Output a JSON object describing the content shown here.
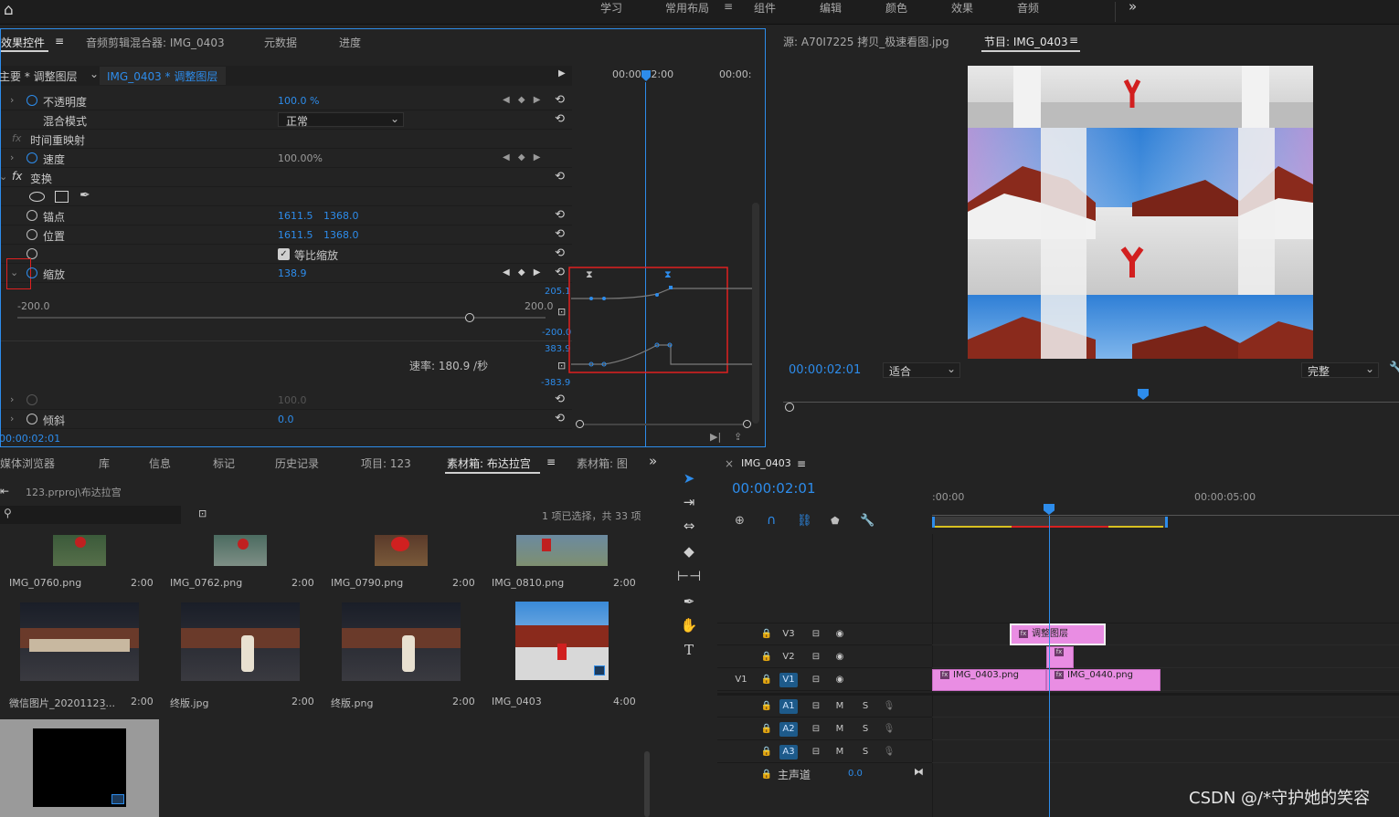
{
  "workspace": {
    "tabs": [
      "学习",
      "常用布局",
      "组件",
      "编辑",
      "颜色",
      "效果",
      "音频"
    ],
    "active_tab": "常用布局",
    "menu_icon": "≡",
    "more_icon": "»",
    "home_icon": "home-icon"
  },
  "effect_controls": {
    "tabs": [
      "效果控件",
      "音频剪辑混合器: IMG_0403",
      "元数据",
      "进度"
    ],
    "active_tab": "效果控件",
    "tab_menu": "≡",
    "source_label": "主要 * 调整图层",
    "sequence_label": "IMG_0403 * 调整图层",
    "ruler_times": [
      "00:00",
      "00:00:02:00",
      "00:00:"
    ],
    "rows": {
      "opacity": {
        "label": "不透明度",
        "value": "100.0 %"
      },
      "blend": {
        "label": "混合模式",
        "value": "正常"
      },
      "time_remap": {
        "label": "时间重映射"
      },
      "speed": {
        "label": "速度",
        "value": "100.00%"
      },
      "transform": {
        "label": "变换"
      },
      "anchor": {
        "label": "锚点",
        "x": "1611.5",
        "y": "1368.0"
      },
      "position": {
        "label": "位置",
        "x": "1611.5",
        "y": "1368.0"
      },
      "uniform": {
        "label": "等比缩放"
      },
      "scale": {
        "label": "缩放",
        "value": "138.9"
      },
      "slider_min": "-200.0",
      "slider_max": "200.0",
      "rate": "速率: 180.9 /秒",
      "g1_top": "205.1",
      "g1_bot": "-200.0",
      "g2_top": "383.9",
      "g2_bot": "-383.9",
      "dim_value": "100.0",
      "skew": {
        "label": "倾斜",
        "value": "0.0"
      }
    },
    "fx_badge": "fx",
    "timecode": "00:00:02:01"
  },
  "program": {
    "source_tab": "源: A70I7225 拷贝_极速看图.jpg",
    "program_tab": "节目: IMG_0403",
    "tab_menu": "≡",
    "timecode": "00:00:02:01",
    "fit": "适合",
    "quality": "完整"
  },
  "project": {
    "tabs": [
      "媒体浏览器",
      "库",
      "信息",
      "标记",
      "历史记录",
      "项目: 123",
      "素材箱: 布达拉宫",
      "素材箱: 图"
    ],
    "active_tab": "素材箱: 布达拉宫",
    "more_icon": "»",
    "path": "123.prproj\\布达拉宫",
    "selection": "1 项已选择，共 33 项",
    "items": [
      {
        "name": "IMG_0760.png",
        "dur": "2:00"
      },
      {
        "name": "IMG_0762.png",
        "dur": "2:00"
      },
      {
        "name": "IMG_0790.png",
        "dur": "2:00"
      },
      {
        "name": "IMG_0810.png",
        "dur": "2:00"
      },
      {
        "name": "微信图片_20201123̲...",
        "dur": "2:00"
      },
      {
        "name": "终版.jpg",
        "dur": "2:00"
      },
      {
        "name": "终版.png",
        "dur": "2:00"
      },
      {
        "name": "IMG_0403",
        "dur": "4:00"
      }
    ]
  },
  "timeline": {
    "title": "IMG_0403",
    "tab_menu": "≡",
    "close_icon": "×",
    "timecode": "00:00:02:01",
    "ruler": [
      ":00:00",
      "00:00:05:00"
    ],
    "tracks": {
      "v3": "V3",
      "v2": "V2",
      "v1": "V1",
      "v1_src": "V1",
      "a1": "A1",
      "a2": "A2",
      "a3": "A3",
      "m": "M",
      "s": "S",
      "master": "主声道",
      "master_val": "0.0"
    },
    "clips": {
      "adjust": "调整图层",
      "c1": "IMG_0403.png",
      "c2": "IMG_0440.png",
      "fx": "fx"
    }
  },
  "watermark": "CSDN @/*守护她的笑容"
}
